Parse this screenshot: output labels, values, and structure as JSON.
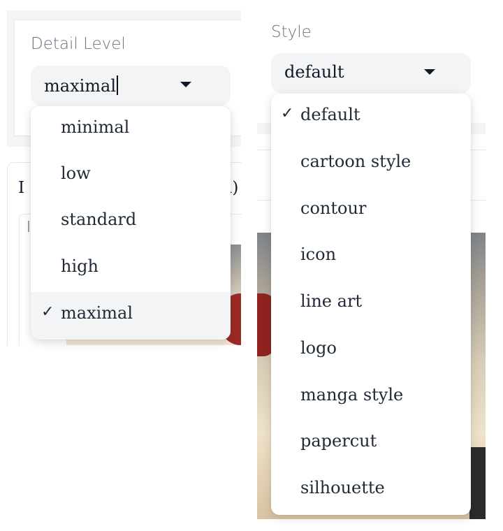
{
  "detail_level": {
    "label": "Detail Level",
    "value": "maximal",
    "options": [
      "minimal",
      "low",
      "standard",
      "high",
      "maximal"
    ],
    "selected": "maximal"
  },
  "style": {
    "label": "Style",
    "value": "default",
    "options": [
      "default",
      "cartoon style",
      "contour",
      "icon",
      "line art",
      "logo",
      "manga style",
      "papercut",
      "silhouette"
    ],
    "selected": "default"
  },
  "background_section": {
    "title_start": "I",
    "title_end": "l)"
  },
  "check_mark": "✓"
}
